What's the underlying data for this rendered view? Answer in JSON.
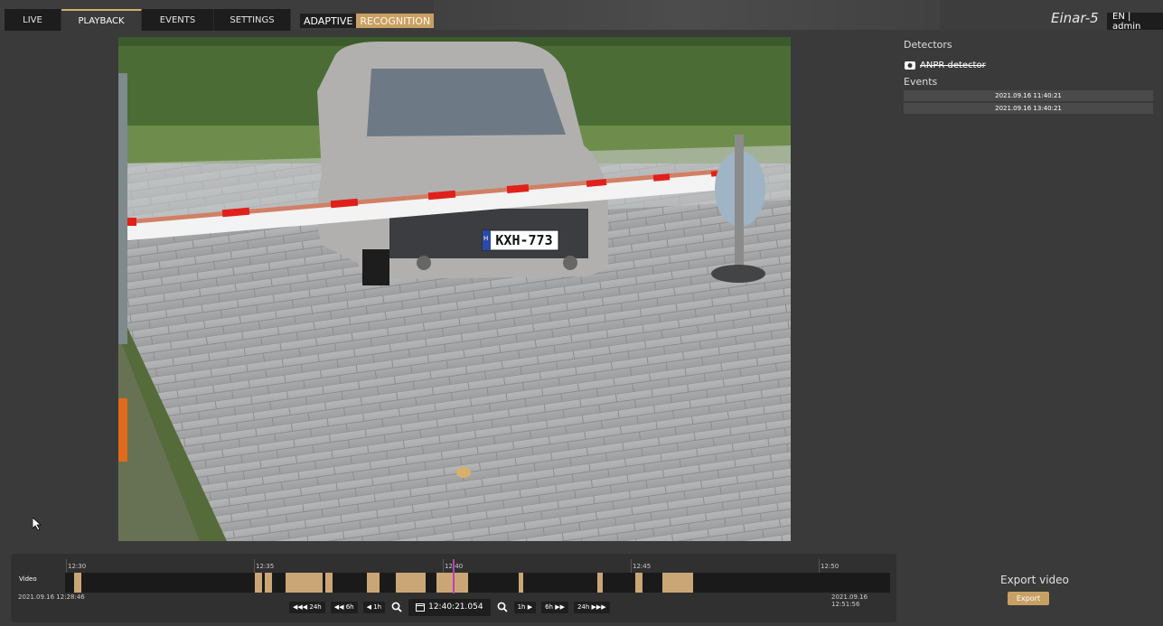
{
  "nav": {
    "tabs": [
      {
        "label": "LIVE"
      },
      {
        "label": "PLAYBACK"
      },
      {
        "label": "EVENTS"
      },
      {
        "label": "SETTINGS"
      }
    ],
    "brand_part1": "ADAPTIVE",
    "brand_part2": "RECOGNITION",
    "app_name": "Einar-5",
    "user_menu": "EN | admin"
  },
  "video": {
    "plate_text": "KXH-773",
    "plate_country": "H"
  },
  "sidebar": {
    "detectors_title": "Detectors",
    "detector_label": "ANPR detector",
    "events_title": "Events",
    "events": [
      {
        "label": "2021.09.16 11:40:21"
      },
      {
        "label": "2021.09.16 13:40:21"
      }
    ]
  },
  "export": {
    "title": "Export video",
    "button": "Export"
  },
  "timeline": {
    "track_label": "Video",
    "ticks": [
      {
        "label": "12:30"
      },
      {
        "label": "12:35"
      },
      {
        "label": "12:40"
      },
      {
        "label": "12:45"
      },
      {
        "label": "12:50"
      }
    ],
    "start_time": "2021.09.16 12:28:46",
    "end_time": "2021.09.16 12:51:56",
    "current_time": "12:40:21.054",
    "btn_back_24h": "◀◀◀ 24h",
    "btn_back_6h": "◀◀ 6h",
    "btn_back_1h": "◀ 1h",
    "btn_fwd_1h": "1h ▶",
    "btn_fwd_6h": "6h ▶▶",
    "btn_fwd_24h": "24h ▶▶▶",
    "colors": {
      "recording": "#caa676",
      "playhead": "#c03fb8",
      "accent": "#d2ad6a"
    }
  }
}
